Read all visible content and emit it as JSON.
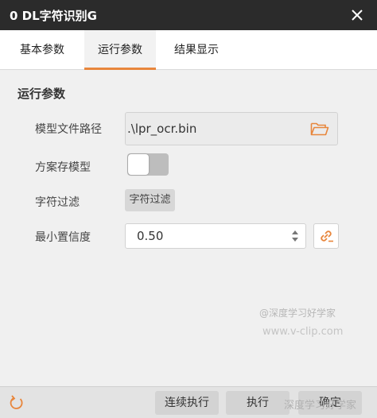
{
  "window": {
    "title": "0 DL字符识别G"
  },
  "tabs": [
    {
      "label": "基本参数"
    },
    {
      "label": "运行参数"
    },
    {
      "label": "结果显示"
    }
  ],
  "active_tab": "运行参数",
  "section": {
    "title": "运行参数"
  },
  "fields": {
    "model_path": {
      "label": "模型文件路径",
      "value": ".\\lpr_ocr.bin"
    },
    "save_model": {
      "label": "方案存模型",
      "toggle_on": false
    },
    "char_filter": {
      "label": "字符过滤",
      "button_label": "字符过滤"
    },
    "min_confidence": {
      "label": "最小置信度",
      "value": "0.50"
    }
  },
  "footer": {
    "continuous_run": "连续执行",
    "run": "执行",
    "confirm": "确定"
  },
  "watermarks": {
    "line1": "@深度学习好学家",
    "line2": "www.v-clip.com",
    "line3": "深度学习好学家"
  },
  "colors": {
    "titlebar_bg": "#2b2b2b",
    "accent": "#e8863c",
    "panel_bg": "#f0f0f0"
  },
  "icons": {
    "close": "close-icon",
    "folder": "folder-open-icon",
    "spin": "spin-arrows-icon",
    "link": "link-icon",
    "reset": "refresh-icon"
  }
}
